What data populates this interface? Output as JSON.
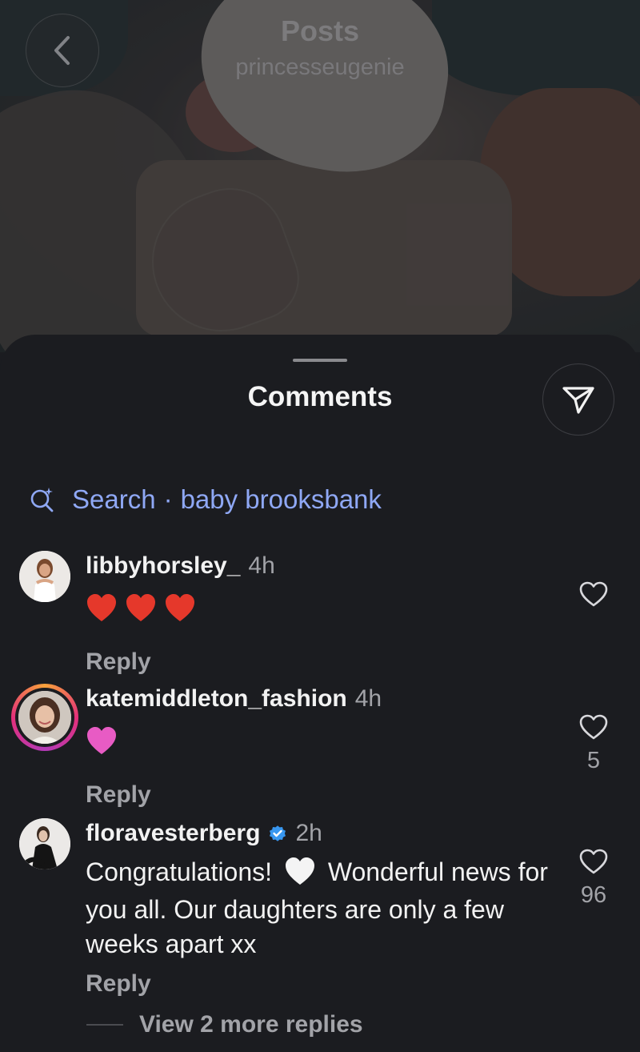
{
  "header": {
    "title": "Posts",
    "subtitle": "princesseugenie"
  },
  "comments_sheet": {
    "title": "Comments",
    "search": {
      "prefix": "Search",
      "separator": "·",
      "query": "baby brooksbank",
      "accent_color": "#8fa8f5"
    },
    "comments": [
      {
        "username": "libbyhorsley_",
        "time": "4h",
        "text": "",
        "emoji": [
          "red-heart",
          "red-heart",
          "red-heart"
        ],
        "reply_label": "Reply",
        "likes": "",
        "verified": false,
        "story_ring": false
      },
      {
        "username": "katemiddleton_fashion",
        "time": "4h",
        "text": "",
        "emoji": [
          "pink-heart"
        ],
        "reply_label": "Reply",
        "likes": "5",
        "verified": false,
        "story_ring": true
      },
      {
        "username": "floravesterberg",
        "time": "2h",
        "text_part1": "Congratulations!",
        "text_part2": "Wonderful news for you all. Our daughters are only a few weeks apart xx",
        "emoji": [
          "white-heart"
        ],
        "reply_label": "Reply",
        "likes": "96",
        "verified": true,
        "story_ring": false
      }
    ],
    "view_more_replies": "View 2 more replies"
  },
  "colors": {
    "background": "#1b1c20",
    "red_heart": "#e5382b",
    "pink_heart": "#e85bc4",
    "verified_blue": "#3897f0"
  }
}
